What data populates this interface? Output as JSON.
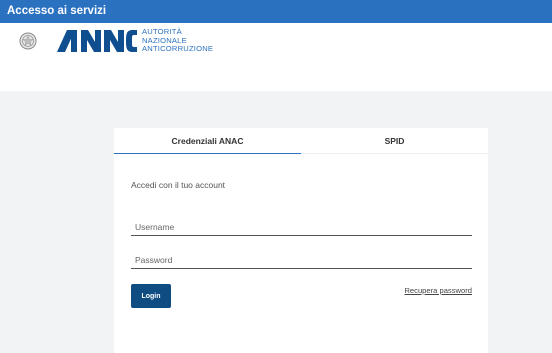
{
  "header": {
    "title": "Accesso ai servizi"
  },
  "brand": {
    "logo": "ANAC",
    "tagline": [
      "AUTORITÀ",
      "NAZIONALE",
      "ANTICORRUZIONE"
    ],
    "emblem_icon": "republic-emblem-icon",
    "color": "#2a72c0"
  },
  "tabs": [
    {
      "label": "Credenziali ANAC",
      "active": true
    },
    {
      "label": "SPID",
      "active": false
    }
  ],
  "form": {
    "intro": "Accedi con il tuo account",
    "username_placeholder": "Username",
    "password_placeholder": "Password",
    "login_label": "Login",
    "recover_label": "Recupera password"
  },
  "colors": {
    "topbar": "#2a72c0",
    "button": "#0f4c81",
    "background": "#f2f3f4"
  }
}
